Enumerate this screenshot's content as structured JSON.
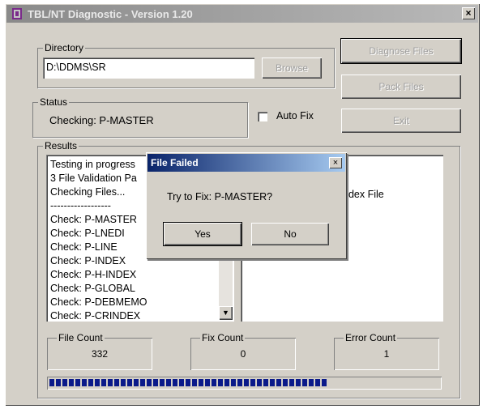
{
  "window": {
    "title": "TBL/NT Diagnostic - Version 1.20",
    "close": "×"
  },
  "directory": {
    "label": "Directory",
    "value": "D:\\DDMS\\SR",
    "browse": "Browse"
  },
  "buttons": {
    "diagnose": "Diagnose Files",
    "pack": "Pack Files",
    "exit": "Exit"
  },
  "status": {
    "label": "Status",
    "text": "Checking: P-MASTER"
  },
  "autofix": {
    "label": "Auto Fix"
  },
  "results": {
    "label": "Results",
    "lines": [
      "Testing in progress",
      "3 File Validation Pa",
      "Checking Files...",
      "------------------",
      "Check: P-MASTER",
      "Check: P-LNEDI",
      "Check: P-LINE",
      "Check: P-INDEX",
      "Check: P-H-INDEX",
      "Check: P-GLOBAL",
      "Check: P-DEBMEMO",
      "Check: P-CRINDEX"
    ],
    "right_text": "ndex File"
  },
  "counts": [
    {
      "label": "File Count",
      "value": "332"
    },
    {
      "label": "Fix Count",
      "value": "0"
    },
    {
      "label": "Error Count",
      "value": "1"
    }
  ],
  "progress": {
    "fraction": 0.73,
    "blocks": 43
  },
  "dialog": {
    "title": "File Failed",
    "message": "Try to Fix: P-MASTER?",
    "yes": "Yes",
    "no": "No",
    "close": "×"
  }
}
